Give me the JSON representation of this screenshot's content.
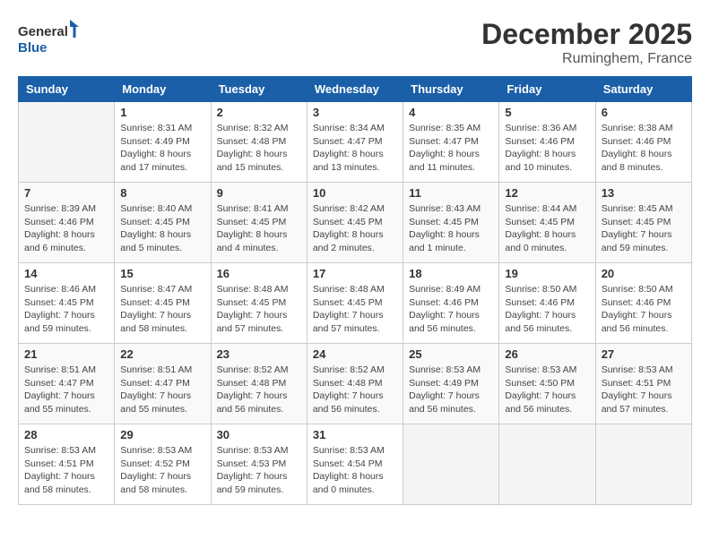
{
  "logo": {
    "text_general": "General",
    "text_blue": "Blue"
  },
  "title": "December 2025",
  "subtitle": "Ruminghem, France",
  "days_of_week": [
    "Sunday",
    "Monday",
    "Tuesday",
    "Wednesday",
    "Thursday",
    "Friday",
    "Saturday"
  ],
  "weeks": [
    [
      {
        "day": "",
        "sunrise": "",
        "sunset": "",
        "daylight": ""
      },
      {
        "day": "1",
        "sunrise": "Sunrise: 8:31 AM",
        "sunset": "Sunset: 4:49 PM",
        "daylight": "Daylight: 8 hours and 17 minutes."
      },
      {
        "day": "2",
        "sunrise": "Sunrise: 8:32 AM",
        "sunset": "Sunset: 4:48 PM",
        "daylight": "Daylight: 8 hours and 15 minutes."
      },
      {
        "day": "3",
        "sunrise": "Sunrise: 8:34 AM",
        "sunset": "Sunset: 4:47 PM",
        "daylight": "Daylight: 8 hours and 13 minutes."
      },
      {
        "day": "4",
        "sunrise": "Sunrise: 8:35 AM",
        "sunset": "Sunset: 4:47 PM",
        "daylight": "Daylight: 8 hours and 11 minutes."
      },
      {
        "day": "5",
        "sunrise": "Sunrise: 8:36 AM",
        "sunset": "Sunset: 4:46 PM",
        "daylight": "Daylight: 8 hours and 10 minutes."
      },
      {
        "day": "6",
        "sunrise": "Sunrise: 8:38 AM",
        "sunset": "Sunset: 4:46 PM",
        "daylight": "Daylight: 8 hours and 8 minutes."
      }
    ],
    [
      {
        "day": "7",
        "sunrise": "Sunrise: 8:39 AM",
        "sunset": "Sunset: 4:46 PM",
        "daylight": "Daylight: 8 hours and 6 minutes."
      },
      {
        "day": "8",
        "sunrise": "Sunrise: 8:40 AM",
        "sunset": "Sunset: 4:45 PM",
        "daylight": "Daylight: 8 hours and 5 minutes."
      },
      {
        "day": "9",
        "sunrise": "Sunrise: 8:41 AM",
        "sunset": "Sunset: 4:45 PM",
        "daylight": "Daylight: 8 hours and 4 minutes."
      },
      {
        "day": "10",
        "sunrise": "Sunrise: 8:42 AM",
        "sunset": "Sunset: 4:45 PM",
        "daylight": "Daylight: 8 hours and 2 minutes."
      },
      {
        "day": "11",
        "sunrise": "Sunrise: 8:43 AM",
        "sunset": "Sunset: 4:45 PM",
        "daylight": "Daylight: 8 hours and 1 minute."
      },
      {
        "day": "12",
        "sunrise": "Sunrise: 8:44 AM",
        "sunset": "Sunset: 4:45 PM",
        "daylight": "Daylight: 8 hours and 0 minutes."
      },
      {
        "day": "13",
        "sunrise": "Sunrise: 8:45 AM",
        "sunset": "Sunset: 4:45 PM",
        "daylight": "Daylight: 7 hours and 59 minutes."
      }
    ],
    [
      {
        "day": "14",
        "sunrise": "Sunrise: 8:46 AM",
        "sunset": "Sunset: 4:45 PM",
        "daylight": "Daylight: 7 hours and 59 minutes."
      },
      {
        "day": "15",
        "sunrise": "Sunrise: 8:47 AM",
        "sunset": "Sunset: 4:45 PM",
        "daylight": "Daylight: 7 hours and 58 minutes."
      },
      {
        "day": "16",
        "sunrise": "Sunrise: 8:48 AM",
        "sunset": "Sunset: 4:45 PM",
        "daylight": "Daylight: 7 hours and 57 minutes."
      },
      {
        "day": "17",
        "sunrise": "Sunrise: 8:48 AM",
        "sunset": "Sunset: 4:45 PM",
        "daylight": "Daylight: 7 hours and 57 minutes."
      },
      {
        "day": "18",
        "sunrise": "Sunrise: 8:49 AM",
        "sunset": "Sunset: 4:46 PM",
        "daylight": "Daylight: 7 hours and 56 minutes."
      },
      {
        "day": "19",
        "sunrise": "Sunrise: 8:50 AM",
        "sunset": "Sunset: 4:46 PM",
        "daylight": "Daylight: 7 hours and 56 minutes."
      },
      {
        "day": "20",
        "sunrise": "Sunrise: 8:50 AM",
        "sunset": "Sunset: 4:46 PM",
        "daylight": "Daylight: 7 hours and 56 minutes."
      }
    ],
    [
      {
        "day": "21",
        "sunrise": "Sunrise: 8:51 AM",
        "sunset": "Sunset: 4:47 PM",
        "daylight": "Daylight: 7 hours and 55 minutes."
      },
      {
        "day": "22",
        "sunrise": "Sunrise: 8:51 AM",
        "sunset": "Sunset: 4:47 PM",
        "daylight": "Daylight: 7 hours and 55 minutes."
      },
      {
        "day": "23",
        "sunrise": "Sunrise: 8:52 AM",
        "sunset": "Sunset: 4:48 PM",
        "daylight": "Daylight: 7 hours and 56 minutes."
      },
      {
        "day": "24",
        "sunrise": "Sunrise: 8:52 AM",
        "sunset": "Sunset: 4:48 PM",
        "daylight": "Daylight: 7 hours and 56 minutes."
      },
      {
        "day": "25",
        "sunrise": "Sunrise: 8:53 AM",
        "sunset": "Sunset: 4:49 PM",
        "daylight": "Daylight: 7 hours and 56 minutes."
      },
      {
        "day": "26",
        "sunrise": "Sunrise: 8:53 AM",
        "sunset": "Sunset: 4:50 PM",
        "daylight": "Daylight: 7 hours and 56 minutes."
      },
      {
        "day": "27",
        "sunrise": "Sunrise: 8:53 AM",
        "sunset": "Sunset: 4:51 PM",
        "daylight": "Daylight: 7 hours and 57 minutes."
      }
    ],
    [
      {
        "day": "28",
        "sunrise": "Sunrise: 8:53 AM",
        "sunset": "Sunset: 4:51 PM",
        "daylight": "Daylight: 7 hours and 58 minutes."
      },
      {
        "day": "29",
        "sunrise": "Sunrise: 8:53 AM",
        "sunset": "Sunset: 4:52 PM",
        "daylight": "Daylight: 7 hours and 58 minutes."
      },
      {
        "day": "30",
        "sunrise": "Sunrise: 8:53 AM",
        "sunset": "Sunset: 4:53 PM",
        "daylight": "Daylight: 7 hours and 59 minutes."
      },
      {
        "day": "31",
        "sunrise": "Sunrise: 8:53 AM",
        "sunset": "Sunset: 4:54 PM",
        "daylight": "Daylight: 8 hours and 0 minutes."
      },
      {
        "day": "",
        "sunrise": "",
        "sunset": "",
        "daylight": ""
      },
      {
        "day": "",
        "sunrise": "",
        "sunset": "",
        "daylight": ""
      },
      {
        "day": "",
        "sunrise": "",
        "sunset": "",
        "daylight": ""
      }
    ]
  ]
}
